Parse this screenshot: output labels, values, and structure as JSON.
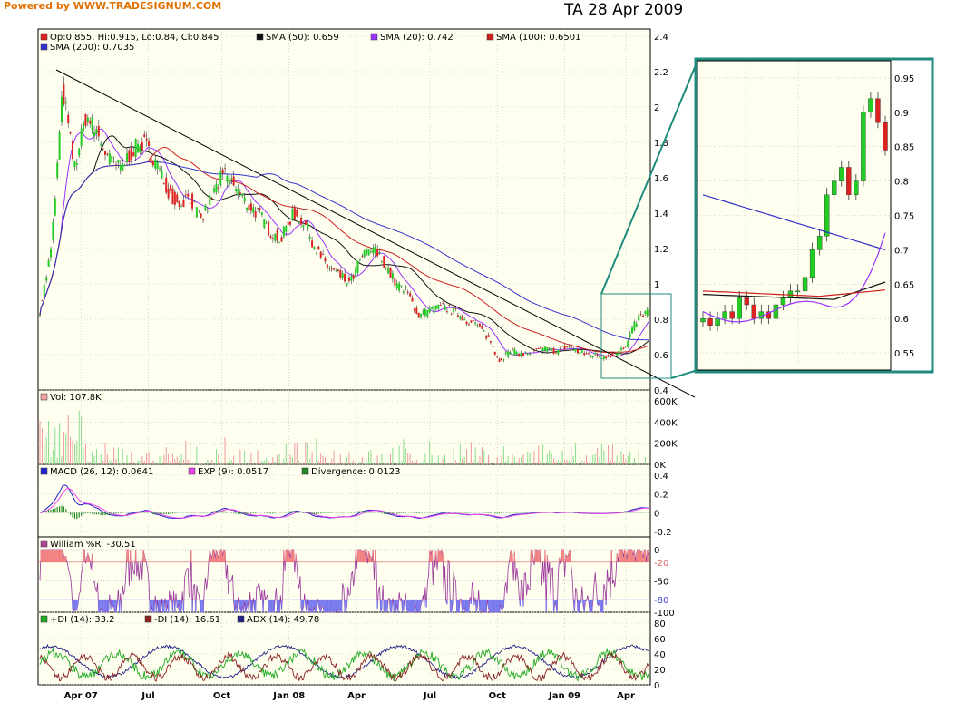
{
  "header": {
    "powered_by": "Powered by WWW.TRADESIGNUM.COM",
    "title": "TA  28 Apr 2009"
  },
  "colors": {
    "panel_bg": "#fffff0",
    "grid": "#bfbfbf",
    "sma50": "#111111",
    "sma20": "#9a33ff",
    "sma100": "#cc2020",
    "sma200": "#3333cc",
    "bull": "#22cc22",
    "bear": "#dd2222",
    "teal": "#1e8b7d"
  },
  "legends": {
    "price": {
      "ohlc": "Op:0.855, Hi:0.915, Lo:0.84, Cl:0.845",
      "sma50": "SMA (50): 0.659",
      "sma20": "SMA (20): 0.742",
      "sma100": "SMA (100): 0.6501",
      "sma200": "SMA (200): 0.7035"
    },
    "volume": "Vol: 107.8K",
    "macd": {
      "macd": "MACD (26, 12): 0.0641",
      "exp": "EXP (9): 0.0517",
      "div": "Divergence: 0.0123"
    },
    "williams": "William %R: -30.51",
    "dmi": {
      "pdi": "+DI (14): 33.2",
      "mdi": "-DI (14): 16.61",
      "adx": "ADX (14): 49.78"
    }
  },
  "chart_data": [
    {
      "type": "candlestick",
      "x": [
        "2007-02-15",
        "2007-03-01",
        "2007-03-15",
        "2007-04-01",
        "2007-04-15",
        "2007-05-01",
        "2007-05-15",
        "2007-06-01",
        "2007-06-15",
        "2007-07-01",
        "2007-07-15",
        "2007-08-01",
        "2007-08-15",
        "2007-09-01",
        "2007-09-15",
        "2007-10-01",
        "2007-10-15",
        "2007-11-01",
        "2007-11-15",
        "2007-12-01",
        "2007-12-15",
        "2008-01-01",
        "2008-01-15",
        "2008-02-01",
        "2008-02-15",
        "2008-03-01",
        "2008-03-15",
        "2008-04-01",
        "2008-04-15",
        "2008-05-01",
        "2008-05-15",
        "2008-06-01",
        "2008-06-15",
        "2008-07-01",
        "2008-07-15",
        "2008-08-01",
        "2008-08-15",
        "2008-09-01",
        "2008-09-15",
        "2008-10-01",
        "2008-10-15",
        "2008-11-01",
        "2008-11-15",
        "2008-12-01",
        "2008-12-15",
        "2009-01-01",
        "2009-01-15",
        "2009-02-01",
        "2009-02-15",
        "2009-03-01",
        "2009-03-15",
        "2009-04-01",
        "2009-04-15",
        "2009-04-28"
      ],
      "close": [
        0.85,
        1.2,
        2.1,
        1.65,
        1.95,
        1.85,
        1.7,
        1.65,
        1.75,
        1.8,
        1.7,
        1.55,
        1.45,
        1.5,
        1.35,
        1.5,
        1.62,
        1.55,
        1.45,
        1.4,
        1.3,
        1.25,
        1.4,
        1.35,
        1.2,
        1.1,
        1.05,
        1.0,
        1.15,
        1.2,
        1.12,
        1.0,
        0.95,
        0.82,
        0.85,
        0.87,
        0.85,
        0.8,
        0.77,
        0.7,
        0.57,
        0.62,
        0.6,
        0.62,
        0.63,
        0.62,
        0.65,
        0.61,
        0.6,
        0.59,
        0.6,
        0.64,
        0.8,
        0.845
      ],
      "overlays": [
        "SMA (50)",
        "SMA (20)",
        "SMA (100)",
        "SMA (200)"
      ],
      "ylim": [
        0.4,
        2.4
      ],
      "yticks": [
        0.4,
        0.6,
        0.8,
        1,
        1.2,
        1.4,
        1.6,
        1.8,
        2,
        2.2,
        2.4
      ],
      "xticks": [
        "Apr 07",
        "Jul",
        "Oct",
        "Jan 08",
        "Apr",
        "Jul",
        "Oct",
        "Jan 09",
        "Apr"
      ]
    },
    {
      "type": "candlestick",
      "panel": "zoom",
      "close": [
        0.6,
        0.59,
        0.6,
        0.61,
        0.6,
        0.63,
        0.62,
        0.6,
        0.61,
        0.6,
        0.62,
        0.63,
        0.64,
        0.64,
        0.66,
        0.7,
        0.72,
        0.78,
        0.8,
        0.82,
        0.78,
        0.8,
        0.9,
        0.92,
        0.885,
        0.845
      ],
      "ylim": [
        0.525,
        0.975
      ],
      "yticks": [
        0.55,
        0.6,
        0.65,
        0.7,
        0.75,
        0.8,
        0.85,
        0.9,
        0.95
      ]
    },
    {
      "type": "bar",
      "panel": "volume",
      "yticks": [
        "600K",
        "400K",
        "200K",
        "0K"
      ]
    },
    {
      "type": "line",
      "panel": "macd",
      "ylim": [
        -0.2,
        0.4
      ],
      "yticks": [
        "0.4",
        "0.2",
        "0",
        "-0.2"
      ]
    },
    {
      "type": "line",
      "panel": "williams",
      "ylim": [
        -100,
        0
      ],
      "yticks": [
        "0",
        "-20",
        "-50",
        "-80",
        "-100"
      ]
    },
    {
      "type": "line",
      "panel": "dmi",
      "ylim": [
        0,
        80
      ],
      "yticks": [
        "80",
        "60",
        "40",
        "20",
        "0"
      ]
    }
  ]
}
